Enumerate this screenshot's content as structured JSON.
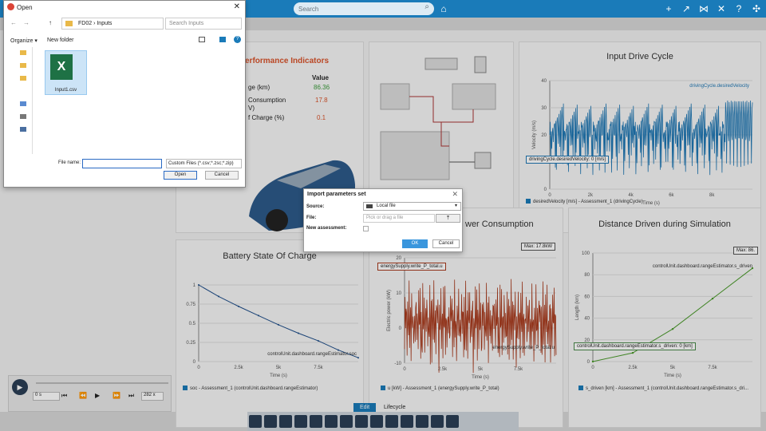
{
  "toolbar": {
    "search_placeholder": "Search"
  },
  "kpi": {
    "title": "erformance Indicators",
    "col_value": "Value",
    "rows": [
      {
        "label": "ge (km)",
        "value": "86.36"
      },
      {
        "label": "Consumption",
        "label2": "V)",
        "value": "17.8"
      },
      {
        "label": "f Charge (%)",
        "value": "0.1"
      }
    ],
    "accent": "#d9532b"
  },
  "panels": {
    "drive_cycle": {
      "title": "Input Drive Cycle",
      "series_label": "drivingCycle.desiredVelocity",
      "tag": "drivingCycle.desiredVelocity: 0 [m/s]",
      "legend": "desiredVelocity [m/s] - Assessment_1 (drivingCycle)"
    },
    "soc": {
      "title": "Battery State Of Charge",
      "series_label": "controlUnit.dashboard.rangeEstimator.soc",
      "legend": "soc - Assessment_1 (controlUnit.dashboard.rangeEstimator)"
    },
    "power": {
      "title": "wer Consumption",
      "series_label": "energySupply.write_P_total.u",
      "tag": "energySupply.write_P_total.u",
      "max_tag": "Max: 17.8kW",
      "legend": "u [kW] - Assessment_1 (energySupply.write_P_total)"
    },
    "distance": {
      "title": "Distance Driven during Simulation",
      "series_label": "controlUnit.dashboard.rangeEstimator.s_driven",
      "tag": "controlUnit.dashboard.rangeEstimator.s_driven: 0 [km]",
      "max_tag": "Max: 86.",
      "legend": "s_driven [km] - Assessment_1 (controlUnit.dashboard.rangeEstimator.s_dri..."
    }
  },
  "chart_data": [
    {
      "type": "line",
      "title": "Input Drive Cycle",
      "xlabel": "Time (s)",
      "ylabel": "Velocity (m/s)",
      "xlim": [
        0,
        10000
      ],
      "ylim": [
        0,
        40
      ],
      "xticks": [
        "0",
        "2k",
        "4k",
        "6k",
        "8k"
      ],
      "yticks": [
        "0",
        "10",
        "20",
        "30",
        "40"
      ],
      "series": [
        {
          "name": "drivingCycle.desiredVelocity",
          "color": "#1f77b4"
        }
      ]
    },
    {
      "type": "line",
      "title": "Battery State Of Charge",
      "xlabel": "Time (s)",
      "ylabel": "",
      "xlim": [
        0,
        10000
      ],
      "ylim": [
        0,
        1
      ],
      "xticks": [
        "0",
        "2.5k",
        "5k",
        "7.5k"
      ],
      "yticks": [
        "0",
        "0.25",
        "0.5",
        "0.75",
        "1"
      ],
      "x": [
        0,
        1250,
        2500,
        3750,
        5000,
        6250,
        7500,
        8750,
        10000
      ],
      "series": [
        {
          "name": "controlUnit.dashboard.rangeEstimator.soc",
          "values": [
            1,
            0.85,
            0.72,
            0.6,
            0.48,
            0.37,
            0.27,
            0.15,
            0.05
          ],
          "color": "#1f4e8a"
        }
      ]
    },
    {
      "type": "line",
      "title": "Power Consumption",
      "xlabel": "Time (s)",
      "ylabel": "Electric power (kW)",
      "xlim": [
        0,
        10000
      ],
      "ylim": [
        -10,
        20
      ],
      "xticks": [
        "0",
        "2.5k",
        "5k",
        "7.5k"
      ],
      "yticks": [
        "-10",
        "0",
        "10",
        "20"
      ],
      "series": [
        {
          "name": "energySupply.write_P_total.u",
          "color": "#a83a1c"
        }
      ]
    },
    {
      "type": "line",
      "title": "Distance Driven during Simulation",
      "xlabel": "Time (s)",
      "ylabel": "Length (km)",
      "xlim": [
        0,
        10000
      ],
      "ylim": [
        0,
        100
      ],
      "xticks": [
        "0",
        "2.5k",
        "5k",
        "7.5k"
      ],
      "yticks": [
        "0",
        "20",
        "40",
        "60",
        "80",
        "100"
      ],
      "x": [
        0,
        2500,
        5000,
        7500,
        10000
      ],
      "series": [
        {
          "name": "controlUnit.dashboard.rangeEstimator.s_driven",
          "values": [
            0,
            8,
            30,
            58,
            86
          ],
          "color": "#4a9a2a"
        }
      ]
    }
  ],
  "player": {
    "time": "0 s",
    "speed": "282 x"
  },
  "bottom_tabs": {
    "edit": "Edit",
    "lifecycle": "Lifecycle"
  },
  "open_dialog": {
    "title": "Open",
    "breadcrumb": [
      "FD02",
      "Inputs"
    ],
    "search_placeholder": "Search Inputs",
    "organize": "Organize",
    "new_folder": "New folder",
    "file_name": "Input1.csv",
    "file_name_label": "File name:",
    "filter": "Custom Files (*.csv;*.zsc;*.zip)",
    "open": "Open",
    "cancel": "Cancel"
  },
  "import_dialog": {
    "title": "Import parameters set",
    "source_label": "Source:",
    "source_value": "Local file",
    "file_label": "File:",
    "file_placeholder": "Pick or drag a file",
    "new_assessment_label": "New assessment:",
    "ok": "OK",
    "cancel": "Cancel"
  }
}
